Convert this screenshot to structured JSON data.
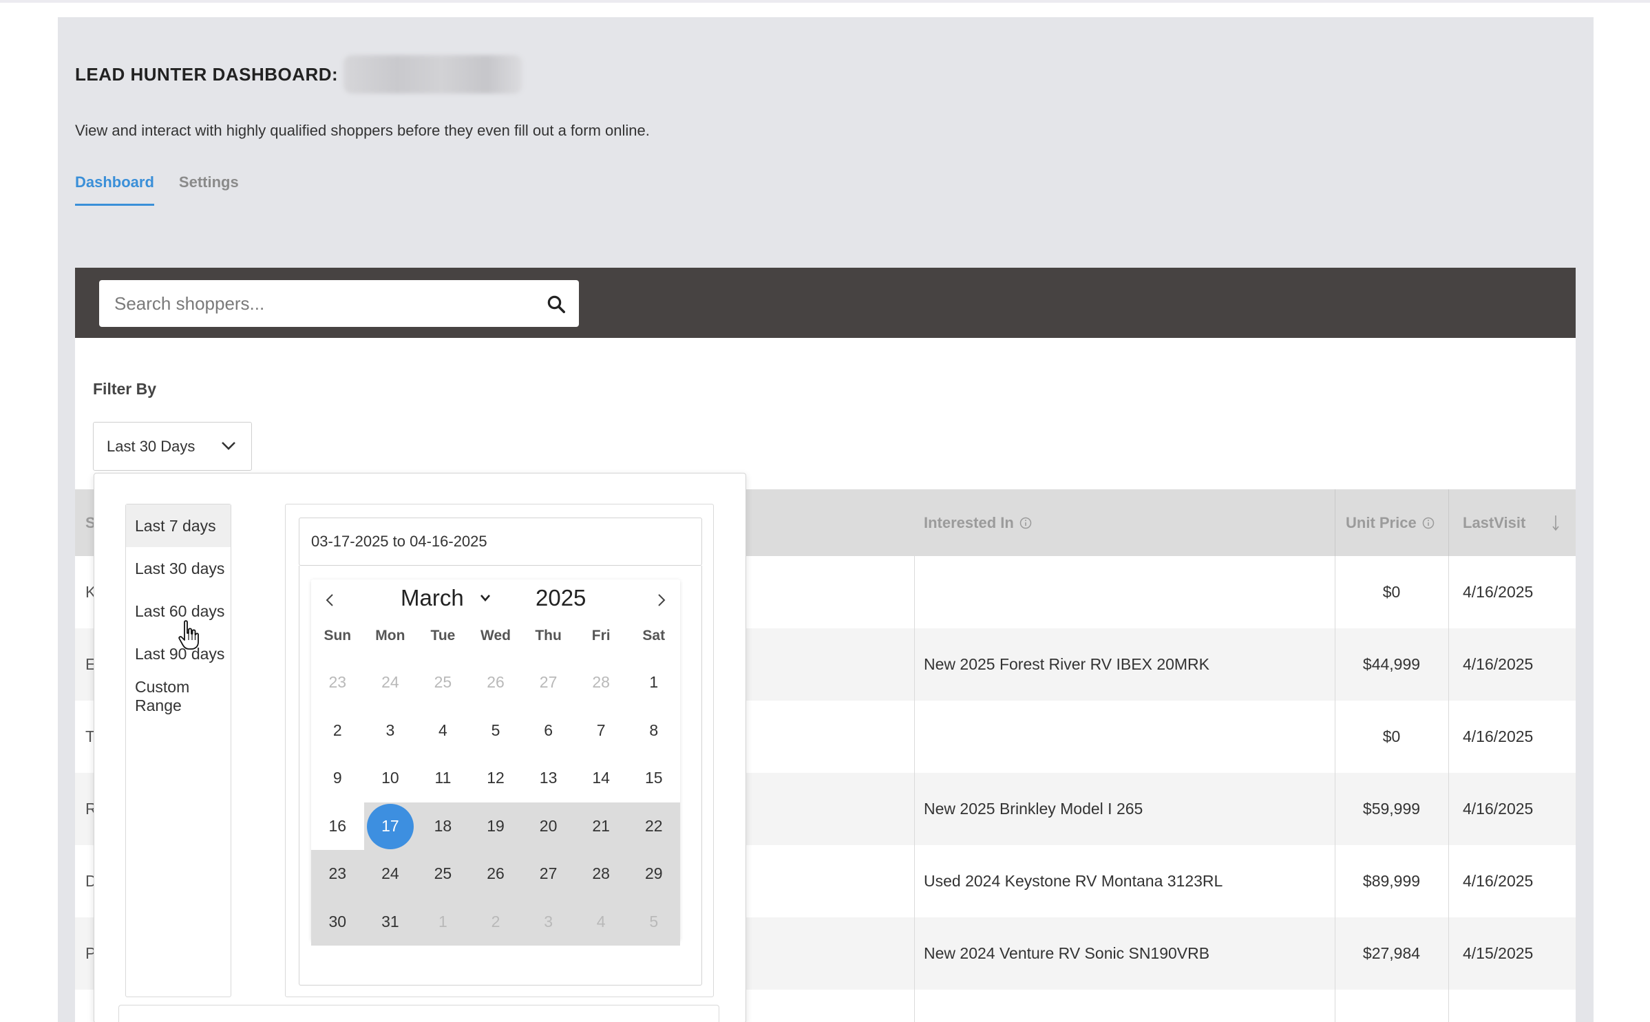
{
  "header": {
    "title": "LEAD HUNTER DASHBOARD:",
    "subtitle": "View and interact with highly qualified shoppers before they even fill out a form online.",
    "tabs": [
      {
        "label": "Dashboard",
        "active": true
      },
      {
        "label": "Settings",
        "active": false
      }
    ]
  },
  "search": {
    "placeholder": "Search shoppers...",
    "value": ""
  },
  "filter": {
    "label": "Filter By",
    "selected": "Last 30 Days"
  },
  "table": {
    "columns": {
      "interested": "Interested In",
      "unit_price": "Unit Price",
      "last_visit": "LastVisit",
      "first_initial": "S"
    },
    "rows": [
      {
        "initial": "K",
        "interested": "",
        "price": "$0",
        "visit": "4/16/2025"
      },
      {
        "initial": "E",
        "interested": "New 2025 Forest River RV IBEX 20MRK",
        "price": "$44,999",
        "visit": "4/16/2025"
      },
      {
        "initial": "T",
        "interested": "",
        "price": "$0",
        "visit": "4/16/2025"
      },
      {
        "initial": "R",
        "interested": "New 2025 Brinkley Model I 265",
        "price": "$59,999",
        "visit": "4/16/2025"
      },
      {
        "initial": "D",
        "interested": "Used 2024 Keystone RV Montana 3123RL",
        "price": "$89,999",
        "visit": "4/16/2025"
      },
      {
        "initial": "P",
        "interested": "New 2024 Venture RV Sonic SN190VRB",
        "price": "$27,984",
        "visit": "4/15/2025"
      }
    ]
  },
  "date_picker": {
    "ranges": [
      "Last 7 days",
      "Last 30 days",
      "Last 60 days",
      "Last 90 days",
      "Custom Range"
    ],
    "hovered_range": "Last 7 days",
    "range_text": "03-17-2025 to 04-16-2025",
    "month": "March",
    "year": "2025",
    "weekdays": [
      "Sun",
      "Mon",
      "Tue",
      "Wed",
      "Thu",
      "Fri",
      "Sat"
    ],
    "weeks": [
      [
        "23",
        "24",
        "25",
        "26",
        "27",
        "28",
        "1"
      ],
      [
        "2",
        "3",
        "4",
        "5",
        "6",
        "7",
        "8"
      ],
      [
        "9",
        "10",
        "11",
        "12",
        "13",
        "14",
        "15"
      ],
      [
        "16",
        "17",
        "18",
        "19",
        "20",
        "21",
        "22"
      ],
      [
        "23",
        "24",
        "25",
        "26",
        "27",
        "28",
        "29"
      ],
      [
        "30",
        "31",
        "1",
        "2",
        "3",
        "4",
        "5"
      ]
    ],
    "selected_day": "17"
  },
  "colors": {
    "accent": "#3a8fd8",
    "search_bar_bg": "#474342",
    "panel_bg": "#e4e5e9",
    "range_highlight": "#dcdcdc",
    "selected_day": "#3d8fe0"
  },
  "icons": {
    "search": "search-icon",
    "dropdown": "chevron-down-icon",
    "info": "info-icon",
    "prev": "chevron-left-icon",
    "next": "chevron-right-icon",
    "sort": "sort-arrow-icon",
    "cursor": "hand-pointer-icon"
  }
}
